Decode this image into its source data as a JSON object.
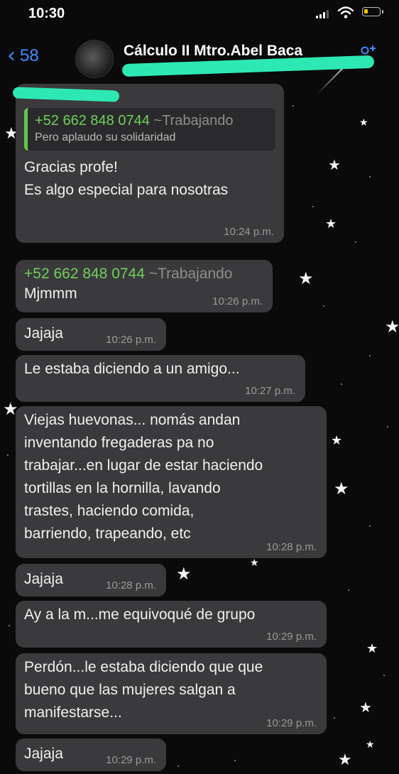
{
  "status_bar": {
    "time": "10:30"
  },
  "header": {
    "back_count": "58",
    "title": "Cálculo II Mtro.Abel Baca",
    "add_icon": "person-add-icon"
  },
  "messages": [
    {
      "quote_sender": "+52 662 848 0744",
      "quote_alias": "~Trabajando",
      "quote_text": "Pero aplaudo su solidaridad",
      "line1": "Gracias profe!",
      "line2": "Es algo especial para nosotras",
      "time": "10:24 p.m."
    },
    {
      "sender": "+52 662 848 0744",
      "alias": "~Trabajando",
      "text": "Mjmmm",
      "time": "10:26 p.m."
    },
    {
      "text": "Jajaja",
      "time": "10:26 p.m."
    },
    {
      "text": "Le estaba diciendo a un amigo...",
      "time": "10:27 p.m."
    },
    {
      "lines": [
        "Viejas huevonas... nomás andan",
        "inventando fregaderas pa no",
        "trabajar...en lugar de estar haciendo",
        "tortillas en la hornilla, lavando",
        "trastes, haciendo comida,",
        "barriendo, trapeando, etc"
      ],
      "time": "10:28 p.m."
    },
    {
      "text": "Jajaja",
      "time": "10:28 p.m."
    },
    {
      "text": "Ay a la m...me equivoqué de grupo",
      "time": "10:29 p.m."
    },
    {
      "lines": [
        "Perdón...le estaba diciendo que que",
        "bueno que las mujeres salgan a",
        "manifestarse..."
      ],
      "time": "10:29 p.m."
    },
    {
      "text": "Jajaja",
      "time": "10:29 p.m."
    }
  ],
  "colors": {
    "background": "#0a0a0a",
    "bubble": "#3a3a3c",
    "sender_green": "#6fcf5a",
    "link_blue": "#3b8cff",
    "redaction": "#2ee8b4"
  }
}
